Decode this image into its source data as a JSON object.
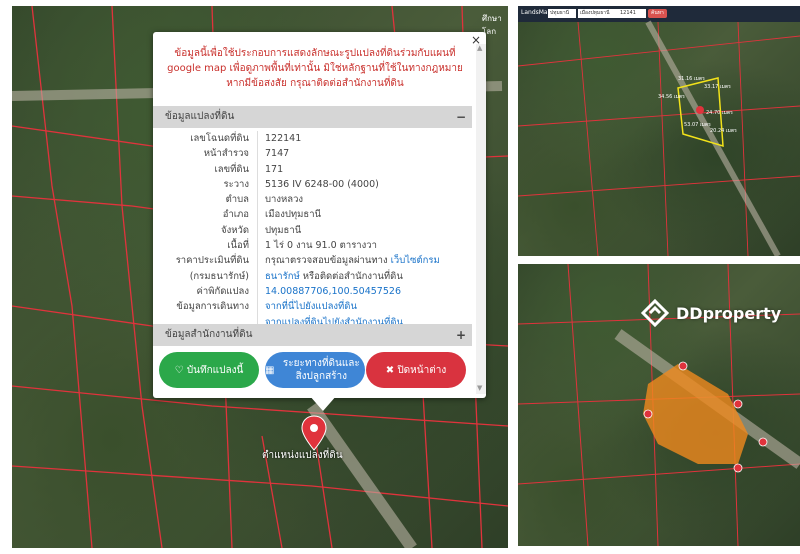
{
  "map_top_label": "ศึกษา โลก",
  "popup": {
    "notice": "ข้อมูลนี้เพื่อใช้ประกอบการแสดงลักษณะรูปแปลงที่ดินร่วมกับแผนที่ google map เพื่อดูภาพพื้นที่เท่านั้น มิใช่หลักฐานที่ใช้ในทางกฎหมาย หากมีข้อสงสัย กรุณาติดต่อสำนักงานที่ดิน",
    "close_glyph": "×",
    "section1_title": "ข้อมูลแปลงที่ดิน",
    "section1_toggle": "−",
    "rows": [
      {
        "key": "เลขโฉนดที่ดิน",
        "value": "122141"
      },
      {
        "key": "หน้าสำรวจ",
        "value": "7147"
      },
      {
        "key": "เลขที่ดิน",
        "value": "171"
      },
      {
        "key": "ระวาง",
        "value": "5136 IV 6248-00 (4000)"
      },
      {
        "key": "ตำบล",
        "value": "บางหลวง"
      },
      {
        "key": "อำเภอ",
        "value": "เมืองปทุมธานี"
      },
      {
        "key": "จังหวัด",
        "value": "ปทุมธานี"
      },
      {
        "key": "เนื้อที่",
        "value": "1 ไร่ 0 งาน 91.0 ตารางวา"
      },
      {
        "key": "ราคาประเมินที่ดิน",
        "value": "กรุณาตรวจสอบข้อมูลผ่านทาง ",
        "link": "เว็บไซต์กรม"
      },
      {
        "key": "(กรมธนารักษ์)",
        "value": " หรือติดต่อสำนักงานที่ดิน",
        "link": "ธนารักษ์"
      },
      {
        "key": "ค่าพิกัดแปลง",
        "link": "14.00887706,100.50457526"
      },
      {
        "key": "ข้อมูลการเดินทาง",
        "link": "จากที่นี่ไปยังแปลงที่ดิน"
      },
      {
        "key": "",
        "link": "จากแปลงที่ดินไปยังสำนักงานที่ดิน"
      }
    ],
    "section2_title": "ข้อมูลสำนักงานที่ดิน",
    "section2_toggle": "+",
    "buttons": {
      "save": "บันทึกแปลงนี้",
      "build": "ระยะทางที่ดินและสิ่งปลูกสร้าง",
      "close": "ปิดหน้าต่าง"
    }
  },
  "pin_label": "ตำแหน่งแปลงที่ดิน",
  "landsmaps_bar": {
    "logo": "LandsMaps",
    "sel1": "ปทุมธานี",
    "sel2": "เมืองปทุมธานี",
    "sel3": "12141",
    "btn": "ค้นหา"
  },
  "measure_labels": [
    "31.16 เมตร",
    "33.17 เมตร",
    "34.56 เมตร",
    "24.70 เมตร",
    "53.07 เมตร",
    "20.24 เมตร"
  ],
  "watermark": "DDproperty",
  "colors": {
    "parcel_line": "#e0333c",
    "highlight": "#f08a1e",
    "measure": "#f2e21a"
  }
}
